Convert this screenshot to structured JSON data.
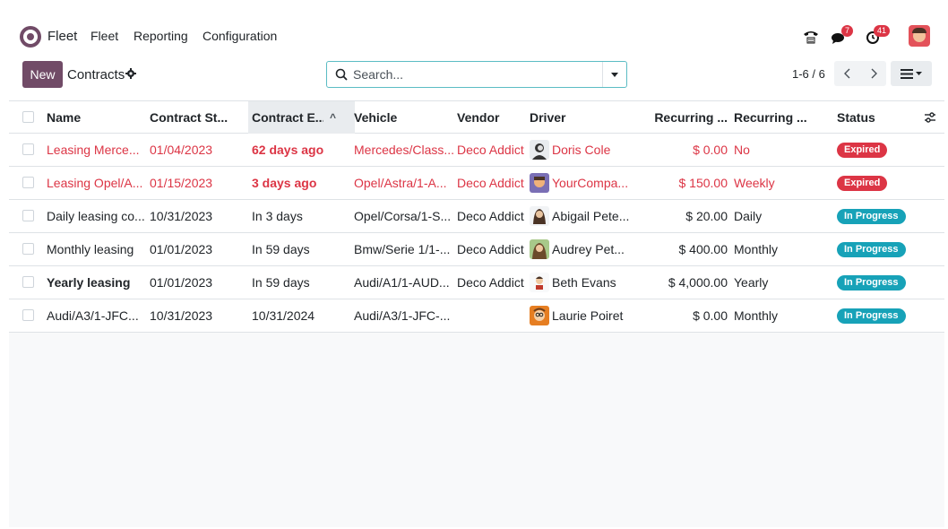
{
  "navbar": {
    "brand": "Fleet",
    "menu": [
      "Fleet",
      "Reporting",
      "Configuration"
    ],
    "icons": [
      "phone-icon",
      "chat-icon",
      "activity-clock-icon"
    ],
    "chat_count": "7",
    "activity_count": "41"
  },
  "control_panel": {
    "new_label": "New",
    "title": "Contracts",
    "search_placeholder": "Search...",
    "pager": "1-6 / 6"
  },
  "table": {
    "headers": {
      "name": "Name",
      "contract_start": "Contract St...",
      "contract_end": "Contract E...",
      "vehicle": "Vehicle",
      "vendor": "Vendor",
      "driver": "Driver",
      "recurring_cost": "Recurring ...",
      "recurring_freq": "Recurring ...",
      "status": "Status"
    },
    "rows": [
      {
        "name": "Leasing Merce...",
        "start": "01/04/2023",
        "end": "62 days ago",
        "vehicle": "Mercedes/Class...",
        "vendor": "Deco Addict",
        "driver": "Doris Cole",
        "cost": "$ 0.00",
        "freq": "No",
        "status": "Expired",
        "state": "expired"
      },
      {
        "name": "Leasing Opel/A...",
        "start": "01/15/2023",
        "end": "3 days ago",
        "vehicle": "Opel/Astra/1-A...",
        "vendor": "Deco Addict",
        "driver": "YourCompa...",
        "cost": "$ 150.00",
        "freq": "Weekly",
        "status": "Expired",
        "state": "expired"
      },
      {
        "name": "Daily leasing co...",
        "start": "10/31/2023",
        "end": "In 3 days",
        "vehicle": "Opel/Corsa/1-S...",
        "vendor": "Deco Addict",
        "driver": "Abigail Pete...",
        "cost": "$ 20.00",
        "freq": "Daily",
        "status": "In Progress",
        "state": "progress"
      },
      {
        "name": "Monthly leasing",
        "start": "01/01/2023",
        "end": "In 59 days",
        "vehicle": "Bmw/Serie 1/1-...",
        "vendor": "Deco Addict",
        "driver": "Audrey Pet...",
        "cost": "$ 400.00",
        "freq": "Monthly",
        "status": "In Progress",
        "state": "progress"
      },
      {
        "name": "Yearly leasing",
        "start": "01/01/2023",
        "end": "In 59 days",
        "vehicle": "Audi/A1/1-AUD...",
        "vendor": "Deco Addict",
        "driver": "Beth Evans",
        "cost": "$ 4,000.00",
        "freq": "Yearly",
        "status": "In Progress",
        "state": "progress"
      },
      {
        "name": "Audi/A3/1-JFC...",
        "start": "10/31/2023",
        "end": "10/31/2024",
        "vehicle": "Audi/A3/1-JFC-...",
        "vendor": "",
        "driver": "Laurie Poiret",
        "cost": "$ 0.00",
        "freq": "Monthly",
        "status": "In Progress",
        "state": "progress"
      }
    ]
  },
  "colors": {
    "brand": "#714b67",
    "expired": "#dc3545",
    "in_progress": "#17a2b8",
    "search_border": "#5bbcc4"
  }
}
